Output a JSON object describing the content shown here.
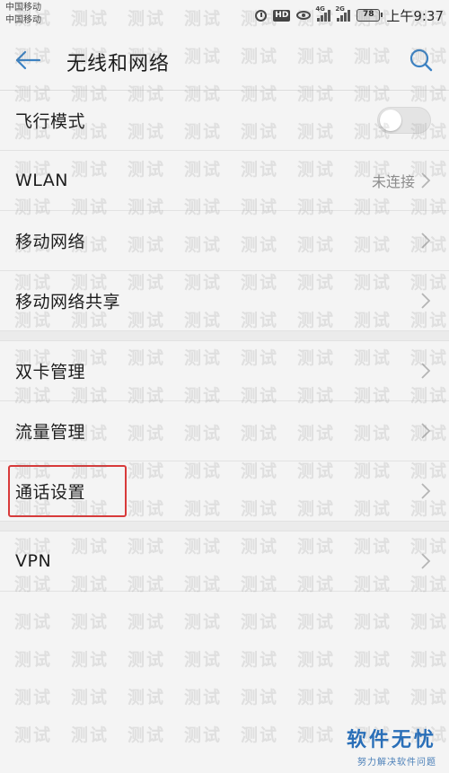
{
  "status_bar": {
    "carrier_1": "中国移动",
    "carrier_2": "中国移动",
    "battery": "78",
    "time": "上午9:37",
    "signal_1_tag": "4G",
    "signal_2_tag": "2G",
    "icons": [
      "alarm-icon",
      "hd-icon",
      "eye-comfort-icon",
      "signal-icon",
      "signal-icon",
      "battery-icon"
    ]
  },
  "app_bar": {
    "back_icon": "back-arrow-icon",
    "title": "无线和网络",
    "search_icon": "search-icon",
    "accent_color": "#3b82c4"
  },
  "list": {
    "airplane": {
      "label": "飞行模式",
      "toggle_on": false
    },
    "wlan": {
      "label": "WLAN",
      "value": "未连接"
    },
    "mobile_network": {
      "label": "移动网络"
    },
    "tethering": {
      "label": "移动网络共享"
    },
    "dual_sim": {
      "label": "双卡管理"
    },
    "data_usage": {
      "label": "流量管理"
    },
    "call_settings": {
      "label": "通话设置",
      "highlighted": true,
      "highlight_color": "#d83a3a"
    },
    "vpn": {
      "label": "VPN"
    }
  },
  "watermark": {
    "text": "测试"
  },
  "brand": {
    "name": "软件无忧",
    "slogan": "努力解决软件问题",
    "color": "#2a6fb8"
  }
}
